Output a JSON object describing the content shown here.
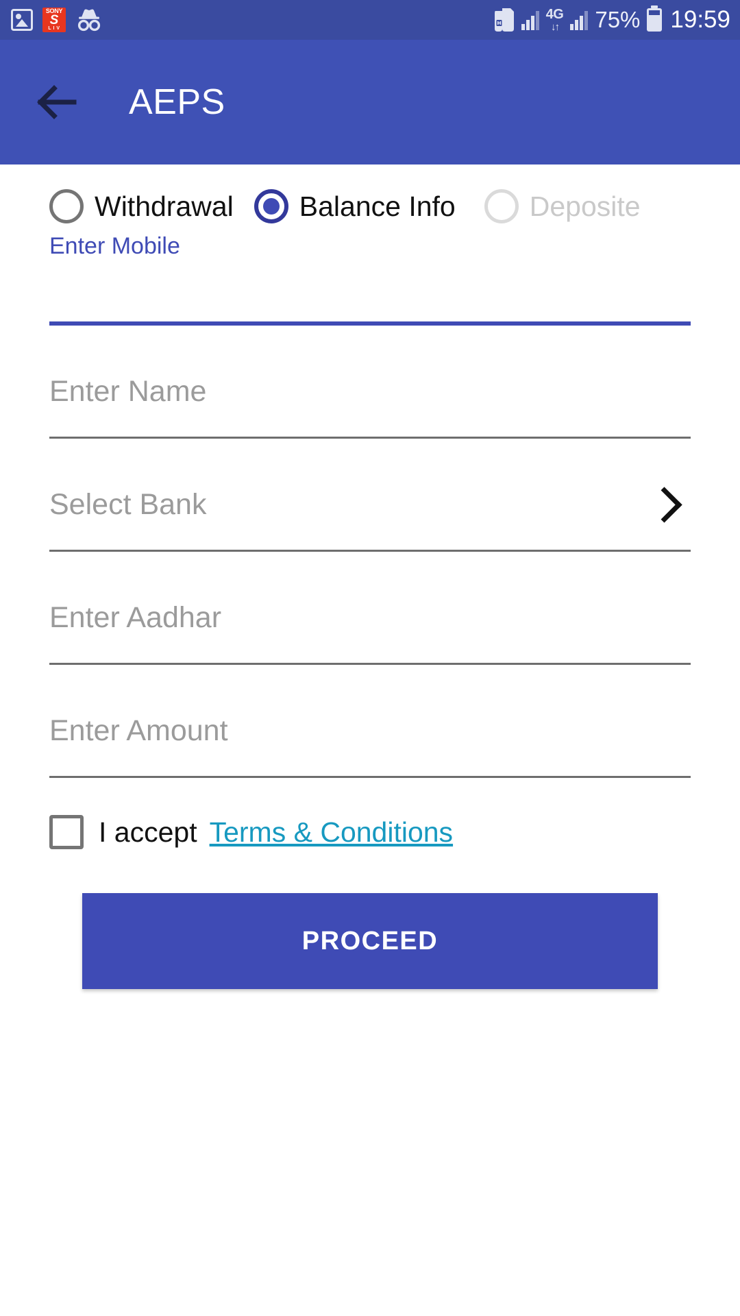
{
  "status_bar": {
    "background": "#3a4ba0",
    "left_icons": [
      {
        "name": "photo-icon",
        "label": "Photo"
      },
      {
        "name": "sonyliv-icon",
        "top": "SONY",
        "mid": "S",
        "bottom": "L I V"
      },
      {
        "name": "incognito-icon",
        "label": "Incognito"
      }
    ],
    "sim_icon": "dual-sim-icon",
    "network_type": "4G",
    "data_arrows": "↓↑",
    "battery_percent": "75%",
    "battery_level": 75,
    "clock": "19:59"
  },
  "app_bar": {
    "background": "#3f51b5",
    "back_icon": "back-arrow-icon",
    "title": "AEPS"
  },
  "form": {
    "transaction_types": [
      {
        "label": "Withdrawal",
        "selected": false,
        "disabled": false
      },
      {
        "label": "Balance Info",
        "selected": true,
        "disabled": false
      },
      {
        "label": "Deposite",
        "selected": false,
        "disabled": true
      }
    ],
    "mobile": {
      "floating_label": "Enter Mobile",
      "value": "",
      "placeholder": "",
      "focused": true,
      "underline_color": "#3f4bb5"
    },
    "name": {
      "placeholder": "Enter Name",
      "value": ""
    },
    "bank": {
      "placeholder": "Select Bank",
      "value": "",
      "chevron_icon": "chevron-right-icon"
    },
    "aadhar": {
      "placeholder": "Enter Aadhar",
      "value": ""
    },
    "amount": {
      "placeholder": "Enter Amount",
      "value": ""
    },
    "terms": {
      "checked": false,
      "accept_text": "I accept",
      "link_text": "Terms & Conditions",
      "link_color": "#1799c0"
    },
    "submit": {
      "label": "PROCEED",
      "background": "#3f4bb5"
    }
  }
}
